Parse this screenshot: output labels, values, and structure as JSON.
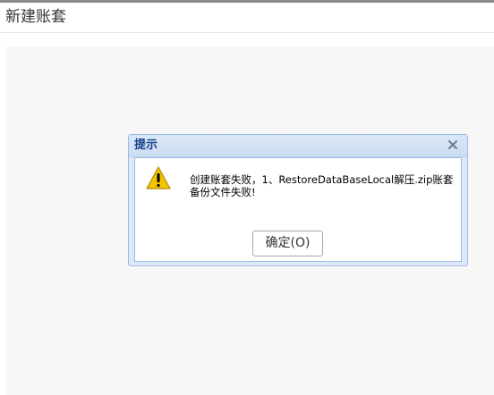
{
  "page": {
    "title": "新建账套"
  },
  "dialog": {
    "title": "提示",
    "message": "创建账套失败，1、RestoreDataBaseLocal解压.zip账套备份文件失败!",
    "ok_label": "确定(O)",
    "icons": {
      "close": "close-icon",
      "warning": "warning-icon"
    }
  },
  "colors": {
    "dialog_title": "#15428b",
    "dialog_border": "#99bbe8",
    "warning": "#f5c400"
  }
}
